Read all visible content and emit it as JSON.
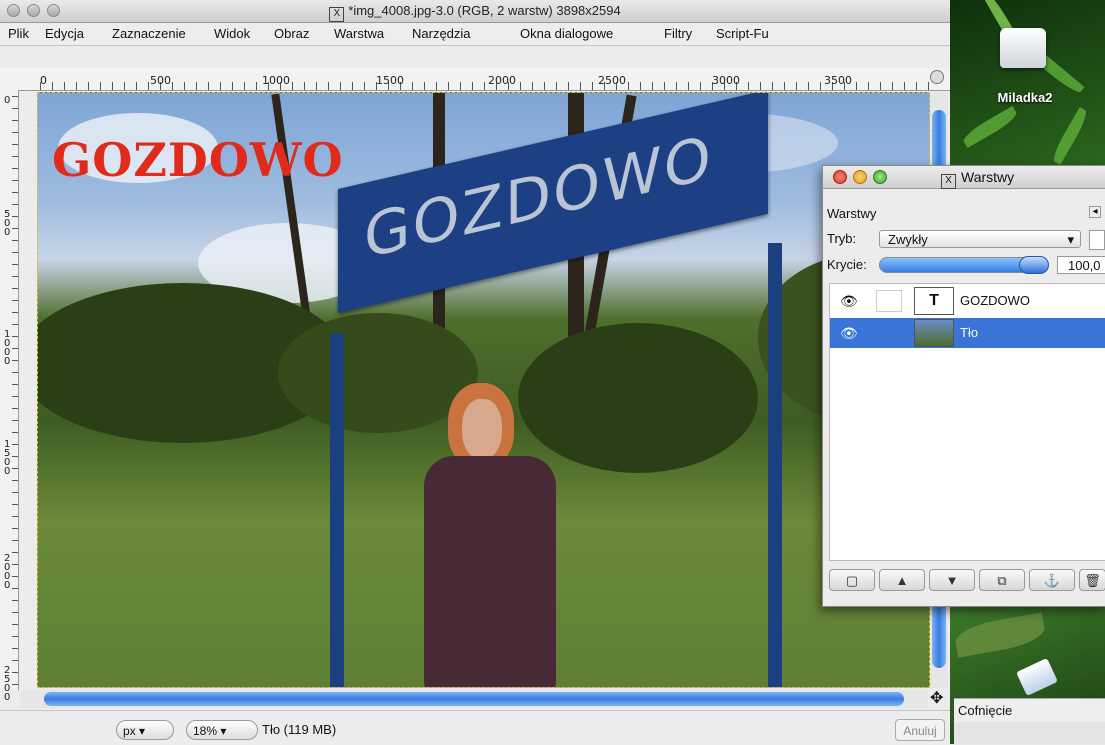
{
  "window": {
    "title": "*img_4008.jpg-3.0 (RGB, 2 warstw) 3898x2594"
  },
  "menubar": {
    "items": [
      "Plik",
      "Edycja",
      "Zaznaczenie",
      "Widok",
      "Obraz",
      "Warstwa",
      "Narzędzia",
      "Okna dialogowe",
      "Filtry",
      "Script-Fu"
    ]
  },
  "ruler": {
    "h_ticks": [
      "0",
      "500",
      "1000",
      "1500",
      "2000",
      "2500",
      "3000",
      "3500"
    ],
    "v_ticks": [
      "0",
      "500",
      "1000",
      "1500",
      "2000",
      "2500"
    ]
  },
  "canvas": {
    "text_layer": "GOZDOWO",
    "sign_text": "GOZDOWO"
  },
  "statusbar": {
    "unit": "px",
    "zoom": "18%",
    "info": "Tło (119 MB)",
    "cancel": "Anuluj"
  },
  "desktop": {
    "drive_label": "Miladka2",
    "undo_label": "Cofnięcie"
  },
  "layers_dialog": {
    "title": "Warstwy",
    "section_label": "Warstwy",
    "mode_label": "Tryb:",
    "mode_value": "Zwykły",
    "opacity_label": "Krycie:",
    "opacity_value": "100,0",
    "layers": [
      {
        "name": "GOZDOWO",
        "visible": true,
        "type": "text",
        "selected": false
      },
      {
        "name": "Tło",
        "visible": true,
        "type": "image",
        "selected": true
      }
    ],
    "buttons": [
      "new-layer",
      "raise-layer",
      "lower-layer",
      "duplicate-layer",
      "anchor-layer",
      "delete-layer"
    ]
  },
  "colors": {
    "selection_blue": "#3875d7",
    "text_layer_red": "#e02a1a",
    "sign_blue": "#1d3f84"
  }
}
